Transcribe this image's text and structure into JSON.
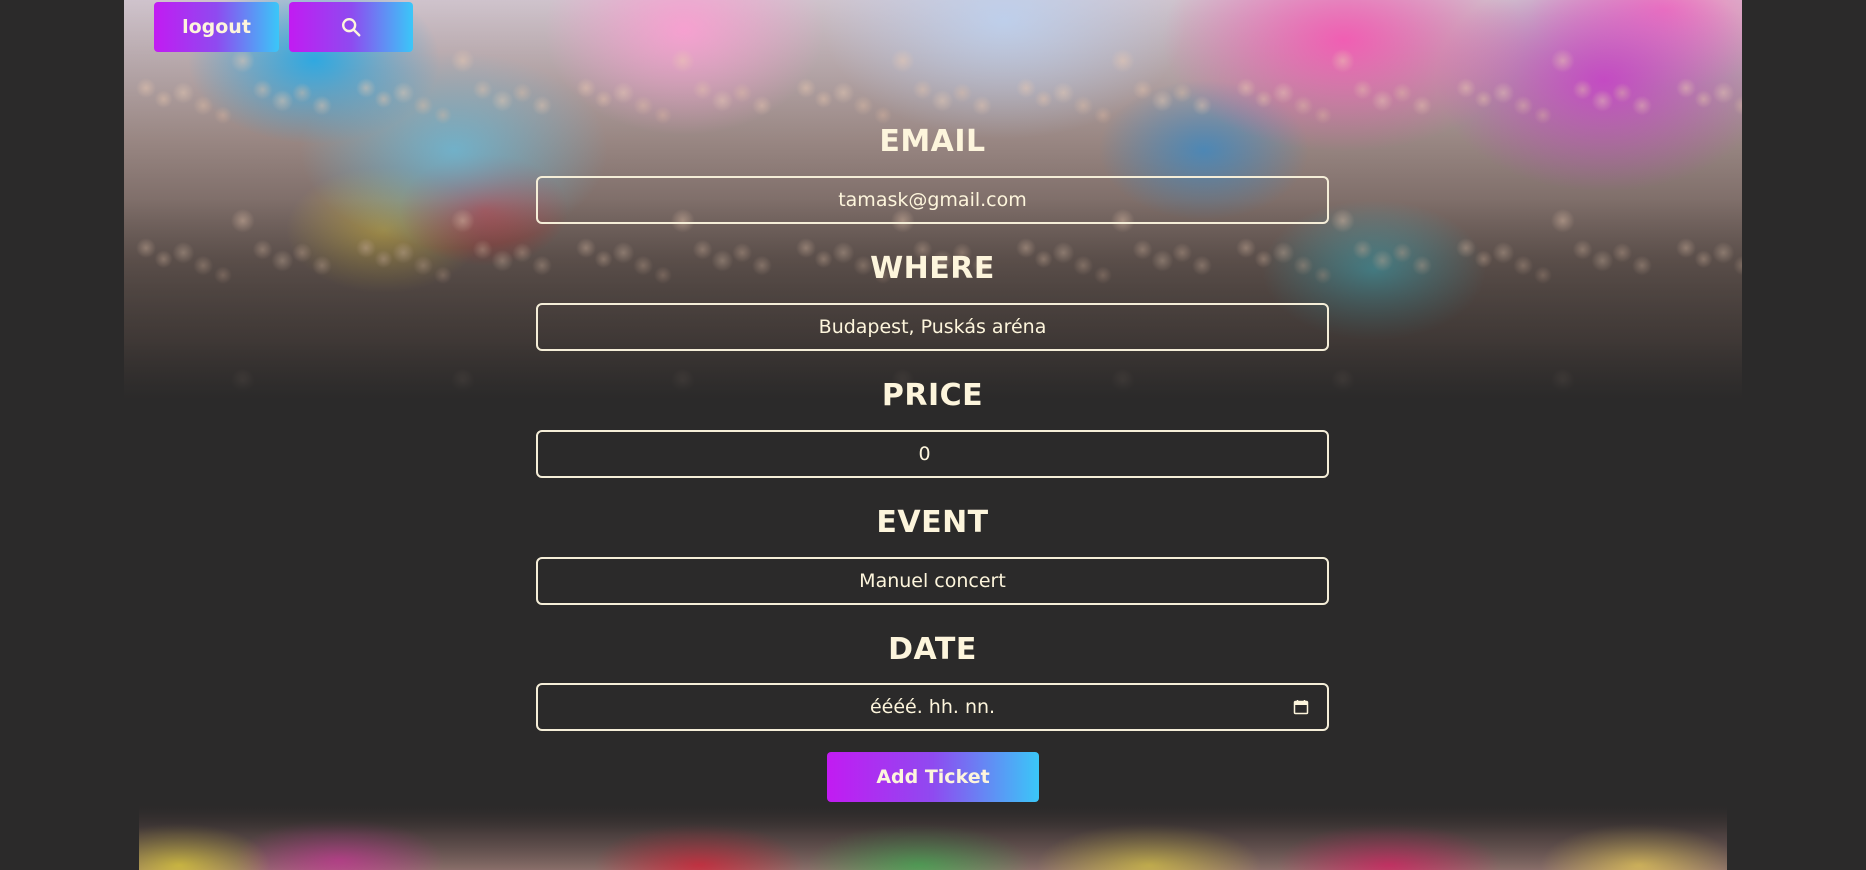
{
  "header": {
    "logout_label": "logout",
    "search_icon": "search-icon"
  },
  "form": {
    "email": {
      "label": "EMAIL",
      "value": "tamask@gmail.com"
    },
    "where": {
      "label": "WHERE",
      "value": "Budapest, Puskás aréna"
    },
    "price": {
      "label": "PRICE",
      "value": "0"
    },
    "event": {
      "label": "EVENT",
      "value": "Manuel concert"
    },
    "date": {
      "label": "DATE",
      "value": "éééé. hh. nn.",
      "icon": "calendar-icon"
    },
    "submit_label": "Add Ticket"
  },
  "colors": {
    "background": "#2b2a2a",
    "text": "#fdf5dc",
    "button_gradient_start": "#c21bf2",
    "button_gradient_end": "#3ac7f8"
  }
}
